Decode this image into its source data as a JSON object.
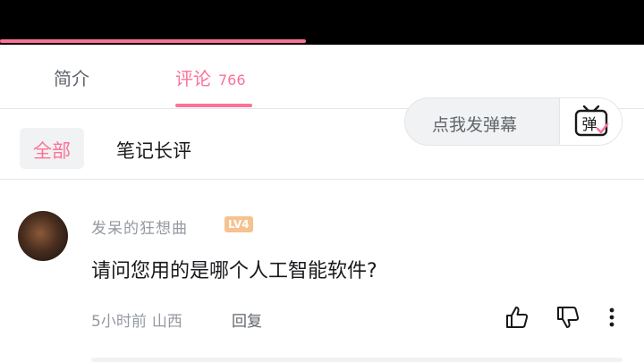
{
  "video": {
    "progress_fraction": 0.475
  },
  "tabs": {
    "intro_label": "简介",
    "comments_label": "评论",
    "comments_count": "766"
  },
  "danmaku": {
    "placeholder": "点我发弹幕",
    "button_glyph": "弹"
  },
  "filters": {
    "all_label": "全部",
    "notes_label": "笔记长评"
  },
  "comment": {
    "username": "发呆的狂想曲",
    "level": "LV4",
    "text": "请问您用的是哪个人工智能软件?",
    "time": "5小时前",
    "location": "山西",
    "reply_label": "回复"
  },
  "colors": {
    "accent": "#fb7299",
    "muted": "#9499a0",
    "text": "#18191c",
    "level_badge": "#f6c28f"
  },
  "icons": {
    "like": "thumbs-up-icon",
    "dislike": "thumbs-down-icon",
    "more": "more-vertical-icon",
    "danmaku": "danmaku-tv-icon"
  }
}
